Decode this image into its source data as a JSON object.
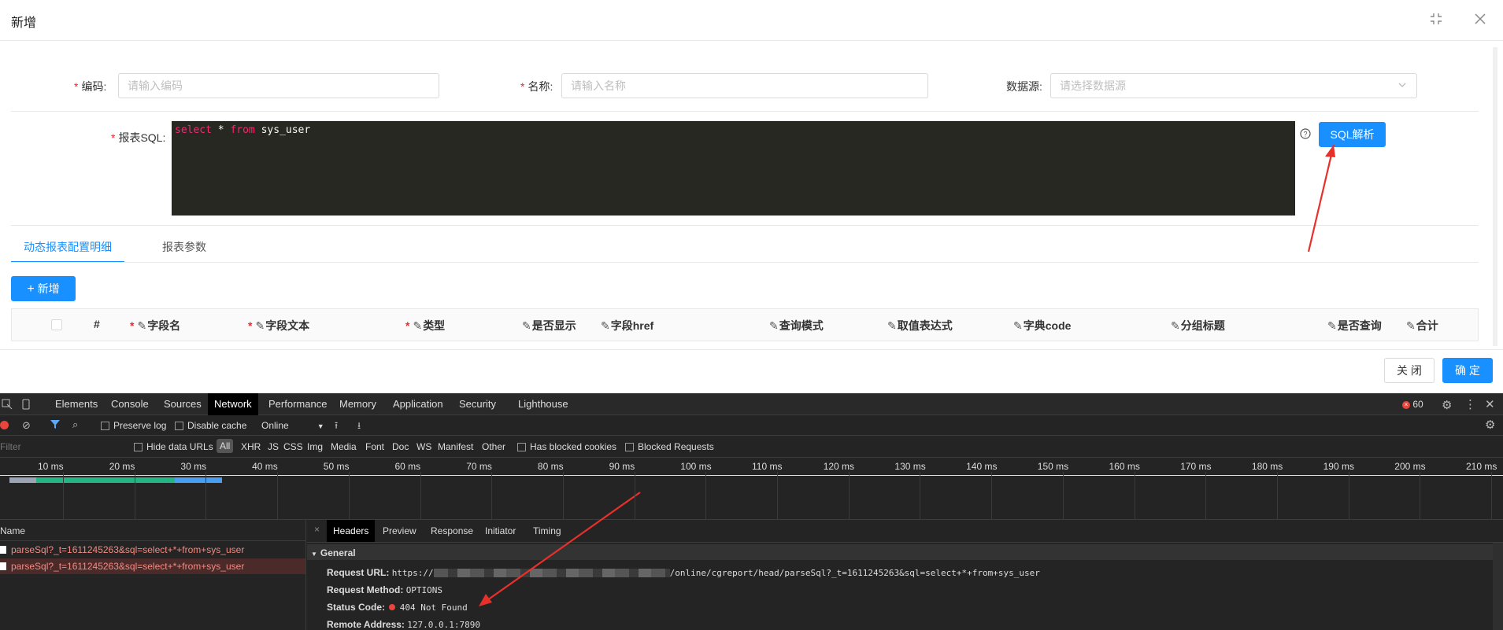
{
  "modal": {
    "title": "新增",
    "fields": {
      "code_label": "编码:",
      "code_placeholder": "请输入编码",
      "name_label": "名称:",
      "name_placeholder": "请输入名称",
      "datasource_label": "数据源:",
      "datasource_placeholder": "请选择数据源",
      "sql_label": "报表SQL:",
      "sql_kw1": "select",
      "sql_mid": " * ",
      "sql_kw2": "from",
      "sql_rest": " sys_user",
      "parse_button": "SQL解析"
    },
    "tabs": [
      "动态报表配置明细",
      "报表参数"
    ],
    "add_button": "新增",
    "table_headers": {
      "index": "#",
      "field_name": "字段名",
      "field_text": "字段文本",
      "type": "类型",
      "is_show": "是否显示",
      "href": "字段href",
      "query_mode": "查询模式",
      "value_expr": "取值表达式",
      "dict_code": "字典code",
      "group_title": "分组标题",
      "is_query": "是否查询",
      "total": "合计"
    },
    "footer": {
      "close": "关 闭",
      "ok": "确 定"
    }
  },
  "devtools": {
    "tabs": [
      "Elements",
      "Console",
      "Sources",
      "Network",
      "Performance",
      "Memory",
      "Application",
      "Security",
      "Lighthouse"
    ],
    "active_tab": "Network",
    "error_count": "60",
    "toolbar": {
      "preserve_log": "Preserve log",
      "disable_cache": "Disable cache",
      "throttle": "Online"
    },
    "filter": {
      "placeholder": "Filter",
      "hide_data_urls": "Hide data URLs",
      "types": [
        "All",
        "XHR",
        "JS",
        "CSS",
        "Img",
        "Media",
        "Font",
        "Doc",
        "WS",
        "Manifest",
        "Other"
      ],
      "has_blocked_cookies": "Has blocked cookies",
      "blocked_requests": "Blocked Requests"
    },
    "timeline_ticks": [
      "10 ms",
      "20 ms",
      "30 ms",
      "40 ms",
      "50 ms",
      "60 ms",
      "70 ms",
      "80 ms",
      "90 ms",
      "100 ms",
      "110 ms",
      "120 ms",
      "130 ms",
      "140 ms",
      "150 ms",
      "160 ms",
      "170 ms",
      "180 ms",
      "190 ms",
      "200 ms",
      "210 ms"
    ],
    "name_header": "Name",
    "requests": [
      "parseSql?_t=1611245263&sql=select+*+from+sys_user",
      "parseSql?_t=1611245263&sql=select+*+from+sys_user"
    ],
    "detail_tabs": [
      "Headers",
      "Preview",
      "Response",
      "Initiator",
      "Timing"
    ],
    "general": {
      "section": "General",
      "request_url_label": "Request URL:",
      "request_url_prefix": "https://",
      "request_url_suffix": "/online/cgreport/head/parseSql?_t=1611245263&sql=select+*+from+sys_user",
      "request_method_label": "Request Method:",
      "request_method": "OPTIONS",
      "status_code_label": "Status Code:",
      "status_code": "404 Not Found",
      "remote_address_label": "Remote Address:",
      "remote_address": "127.0.0.1:7890"
    }
  },
  "colors": {
    "primary": "#1890ff",
    "required": "#f5222d",
    "annotation_arrow": "#e8302a"
  }
}
